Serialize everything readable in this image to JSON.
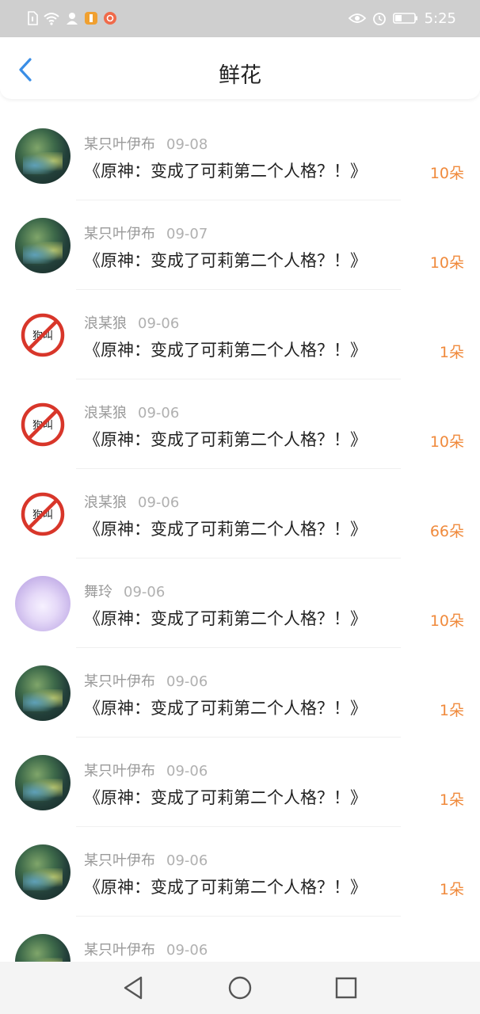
{
  "status_bar": {
    "time": "5:25",
    "left_icons": [
      "sim-card-icon",
      "wifi-icon",
      "app-notification-icon",
      "app-notification-icon-2",
      "app-notification-icon-3"
    ],
    "right_icons": [
      "eye-icon",
      "alarm-icon",
      "battery-icon"
    ]
  },
  "header": {
    "title": "鲜花",
    "back_icon": "chevron-left-icon"
  },
  "colors": {
    "accent": "#3a8ee6",
    "count": "#f08a3c",
    "name": "#9a9a9a",
    "title_text": "#222222"
  },
  "list": {
    "items": [
      {
        "avatar": "forest",
        "name": "某只叶伊布",
        "date": "09-08",
        "book": "《原神：变成了可莉第二个人格？！》",
        "count": "10朵"
      },
      {
        "avatar": "forest",
        "name": "某只叶伊布",
        "date": "09-07",
        "book": "《原神：变成了可莉第二个人格？！》",
        "count": "10朵"
      },
      {
        "avatar": "forbid",
        "name": "浪某狼",
        "date": "09-06",
        "book": "《原神：变成了可莉第二个人格？！》",
        "count": "1朵",
        "avatar_text": "狗叫"
      },
      {
        "avatar": "forbid",
        "name": "浪某狼",
        "date": "09-06",
        "book": "《原神：变成了可莉第二个人格？！》",
        "count": "10朵",
        "avatar_text": "狗叫"
      },
      {
        "avatar": "forbid",
        "name": "浪某狼",
        "date": "09-06",
        "book": "《原神：变成了可莉第二个人格？！》",
        "count": "66朵",
        "avatar_text": "狗叫"
      },
      {
        "avatar": "anime",
        "name": "舞玲",
        "date": "09-06",
        "book": "《原神：变成了可莉第二个人格？！》",
        "count": "10朵"
      },
      {
        "avatar": "forest",
        "name": "某只叶伊布",
        "date": "09-06",
        "book": "《原神：变成了可莉第二个人格？！》",
        "count": "1朵"
      },
      {
        "avatar": "forest",
        "name": "某只叶伊布",
        "date": "09-06",
        "book": "《原神：变成了可莉第二个人格？！》",
        "count": "1朵"
      },
      {
        "avatar": "forest",
        "name": "某只叶伊布",
        "date": "09-06",
        "book": "《原神：变成了可莉第二个人格？！》",
        "count": "1朵"
      },
      {
        "avatar": "forest",
        "name": "某只叶伊布",
        "date": "09-06",
        "book": "",
        "count": ""
      }
    ]
  },
  "nav_bar": {
    "icons": [
      "triangle-back-icon",
      "circle-home-icon",
      "square-recents-icon"
    ]
  }
}
